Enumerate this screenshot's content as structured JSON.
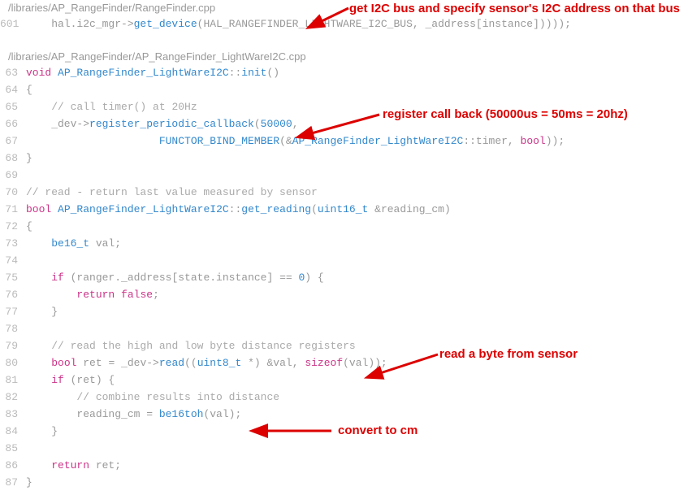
{
  "file1": {
    "path": "/libraries/AP_RangeFinder/RangeFinder.cpp",
    "lines": [
      {
        "no": "601",
        "tokens": [
          {
            "t": "    hal.i2c_mgr->",
            "c": "ident"
          },
          {
            "t": "get_device",
            "c": "fn"
          },
          {
            "t": "(HAL_RANGEFINDER_LIGHTWARE_I2C_BUS, _address[instance]))));",
            "c": "ident"
          }
        ]
      }
    ]
  },
  "file2": {
    "path": "/libraries/AP_RangeFinder/AP_RangeFinder_LightWareI2C.cpp",
    "lines": [
      {
        "no": "63",
        "tokens": [
          {
            "t": "void",
            "c": "kw"
          },
          {
            "t": " ",
            "c": "ident"
          },
          {
            "t": "AP_RangeFinder_LightWareI2C",
            "c": "scope"
          },
          {
            "t": "::",
            "c": "ident"
          },
          {
            "t": "init",
            "c": "fn"
          },
          {
            "t": "()",
            "c": "ident"
          }
        ]
      },
      {
        "no": "64",
        "tokens": [
          {
            "t": "{",
            "c": "ident"
          }
        ]
      },
      {
        "no": "65",
        "tokens": [
          {
            "t": "    ",
            "c": "ident"
          },
          {
            "t": "// call timer() at 20Hz",
            "c": "comment"
          }
        ]
      },
      {
        "no": "66",
        "tokens": [
          {
            "t": "    _dev->",
            "c": "ident"
          },
          {
            "t": "register_periodic_callback",
            "c": "fn"
          },
          {
            "t": "(",
            "c": "ident"
          },
          {
            "t": "50000",
            "c": "num"
          },
          {
            "t": ",",
            "c": "ident"
          }
        ]
      },
      {
        "no": "67",
        "tokens": [
          {
            "t": "                     ",
            "c": "ident"
          },
          {
            "t": "FUNCTOR_BIND_MEMBER",
            "c": "fn"
          },
          {
            "t": "(&",
            "c": "ident"
          },
          {
            "t": "AP_RangeFinder_LightWareI2C",
            "c": "scope"
          },
          {
            "t": "::timer, ",
            "c": "ident"
          },
          {
            "t": "bool",
            "c": "kw"
          },
          {
            "t": "));",
            "c": "ident"
          }
        ]
      },
      {
        "no": "68",
        "tokens": [
          {
            "t": "}",
            "c": "ident"
          }
        ]
      },
      {
        "no": "69",
        "tokens": []
      },
      {
        "no": "70",
        "tokens": [
          {
            "t": "// read - return last value measured by sensor",
            "c": "comment"
          }
        ]
      },
      {
        "no": "71",
        "tokens": [
          {
            "t": "bool",
            "c": "kw"
          },
          {
            "t": " ",
            "c": "ident"
          },
          {
            "t": "AP_RangeFinder_LightWareI2C",
            "c": "scope"
          },
          {
            "t": "::",
            "c": "ident"
          },
          {
            "t": "get_reading",
            "c": "fn"
          },
          {
            "t": "(",
            "c": "ident"
          },
          {
            "t": "uint16_t",
            "c": "type"
          },
          {
            "t": " &reading_cm)",
            "c": "ident"
          }
        ]
      },
      {
        "no": "72",
        "tokens": [
          {
            "t": "{",
            "c": "ident"
          }
        ]
      },
      {
        "no": "73",
        "tokens": [
          {
            "t": "    ",
            "c": "ident"
          },
          {
            "t": "be16_t",
            "c": "type"
          },
          {
            "t": " val;",
            "c": "ident"
          }
        ]
      },
      {
        "no": "74",
        "tokens": []
      },
      {
        "no": "75",
        "tokens": [
          {
            "t": "    ",
            "c": "ident"
          },
          {
            "t": "if",
            "c": "kw"
          },
          {
            "t": " (ranger._address[state.instance] == ",
            "c": "ident"
          },
          {
            "t": "0",
            "c": "num"
          },
          {
            "t": ") {",
            "c": "ident"
          }
        ]
      },
      {
        "no": "76",
        "tokens": [
          {
            "t": "        ",
            "c": "ident"
          },
          {
            "t": "return",
            "c": "kw"
          },
          {
            "t": " ",
            "c": "ident"
          },
          {
            "t": "false",
            "c": "kw"
          },
          {
            "t": ";",
            "c": "ident"
          }
        ]
      },
      {
        "no": "77",
        "tokens": [
          {
            "t": "    }",
            "c": "ident"
          }
        ]
      },
      {
        "no": "78",
        "tokens": []
      },
      {
        "no": "79",
        "tokens": [
          {
            "t": "    ",
            "c": "ident"
          },
          {
            "t": "// read the high and low byte distance registers",
            "c": "comment"
          }
        ]
      },
      {
        "no": "80",
        "tokens": [
          {
            "t": "    ",
            "c": "ident"
          },
          {
            "t": "bool",
            "c": "kw"
          },
          {
            "t": " ret = _dev->",
            "c": "ident"
          },
          {
            "t": "read",
            "c": "fn"
          },
          {
            "t": "((",
            "c": "ident"
          },
          {
            "t": "uint8_t",
            "c": "type"
          },
          {
            "t": " *) &val, ",
            "c": "ident"
          },
          {
            "t": "sizeof",
            "c": "kw"
          },
          {
            "t": "(val));",
            "c": "ident"
          }
        ]
      },
      {
        "no": "81",
        "tokens": [
          {
            "t": "    ",
            "c": "ident"
          },
          {
            "t": "if",
            "c": "kw"
          },
          {
            "t": " (ret) {",
            "c": "ident"
          }
        ]
      },
      {
        "no": "82",
        "tokens": [
          {
            "t": "        ",
            "c": "ident"
          },
          {
            "t": "// combine results into distance",
            "c": "comment"
          }
        ]
      },
      {
        "no": "83",
        "tokens": [
          {
            "t": "        reading_cm = ",
            "c": "ident"
          },
          {
            "t": "be16toh",
            "c": "fn"
          },
          {
            "t": "(val);",
            "c": "ident"
          }
        ]
      },
      {
        "no": "84",
        "tokens": [
          {
            "t": "    }",
            "c": "ident"
          }
        ]
      },
      {
        "no": "85",
        "tokens": []
      },
      {
        "no": "86",
        "tokens": [
          {
            "t": "    ",
            "c": "ident"
          },
          {
            "t": "return",
            "c": "kw"
          },
          {
            "t": " ret;",
            "c": "ident"
          }
        ]
      },
      {
        "no": "87",
        "tokens": [
          {
            "t": "}",
            "c": "ident"
          }
        ]
      }
    ]
  },
  "annotations": {
    "a1": "get I2C bus and specify sensor's I2C address on that bus",
    "a2": "register call back (50000us = 50ms = 20hz)",
    "a3": "read a byte from sensor",
    "a4": "convert to cm"
  }
}
